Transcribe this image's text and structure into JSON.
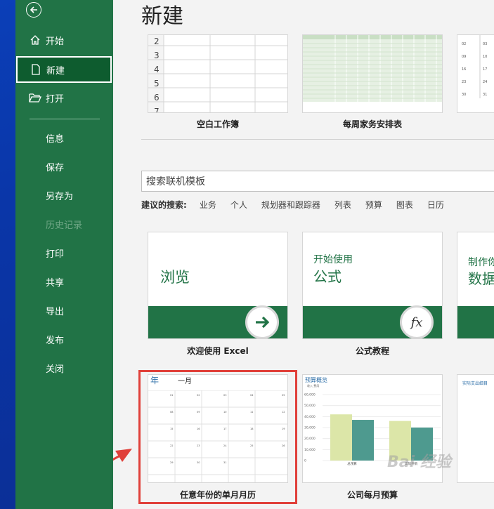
{
  "page_title": "新建",
  "sidebar": {
    "back_icon": "back-arrow-icon",
    "items": [
      {
        "label": "开始",
        "icon": "home-icon"
      },
      {
        "label": "新建",
        "icon": "new-file-icon"
      },
      {
        "label": "打开",
        "icon": "folder-open-icon"
      },
      {
        "label": "信息"
      },
      {
        "label": "保存"
      },
      {
        "label": "另存为"
      },
      {
        "label": "历史记录"
      },
      {
        "label": "打印"
      },
      {
        "label": "共享"
      },
      {
        "label": "导出"
      },
      {
        "label": "发布"
      },
      {
        "label": "关闭"
      }
    ]
  },
  "templates_top": [
    {
      "label": "空白工作簿",
      "rows": [
        "2",
        "3",
        "4",
        "5",
        "6",
        "7"
      ]
    },
    {
      "label": "每周家务安排表"
    }
  ],
  "search": {
    "placeholder": "搜索联机模板"
  },
  "suggestions": {
    "heading": "建议的搜索:",
    "items": [
      "业务",
      "个人",
      "规划器和跟踪器",
      "列表",
      "预算",
      "图表",
      "日历"
    ]
  },
  "featured": [
    {
      "label": "欢迎使用 Excel",
      "title": "浏览",
      "icon": "arrow-right-icon"
    },
    {
      "label": "公式教程",
      "title_line1": "开始使用",
      "title_line2": "公式",
      "icon": "fx-icon",
      "icon_text": "fx"
    },
    {
      "title_line1": "制作你",
      "title_line2": "数据"
    }
  ],
  "bottom_templates": [
    {
      "label": "任意年份的单月月历",
      "year_text": "年",
      "month_text": "一月"
    },
    {
      "label": "公司每月预算",
      "chart_title": "预算概览",
      "legend": [
        "收入",
        "费用"
      ]
    },
    {
      "title": "实际支出细目"
    }
  ],
  "budget_chart": {
    "yticks": [
      "60,000",
      "50,000",
      "40,000",
      "30,000",
      "20,000",
      "10,000",
      "0"
    ],
    "ylim": [
      0,
      60000
    ],
    "categories": [
      "总预算",
      "实际开销"
    ],
    "series": [
      {
        "name": "收入",
        "values": [
          42000,
          36000
        ],
        "color": "#dce6a8"
      },
      {
        "name": "费用",
        "values": [
          37000,
          30000
        ],
        "color": "#4e9a8f"
      }
    ]
  },
  "watermark": "Bai 经验",
  "colors": {
    "accent": "#217346",
    "highlight": "#e0403a"
  }
}
